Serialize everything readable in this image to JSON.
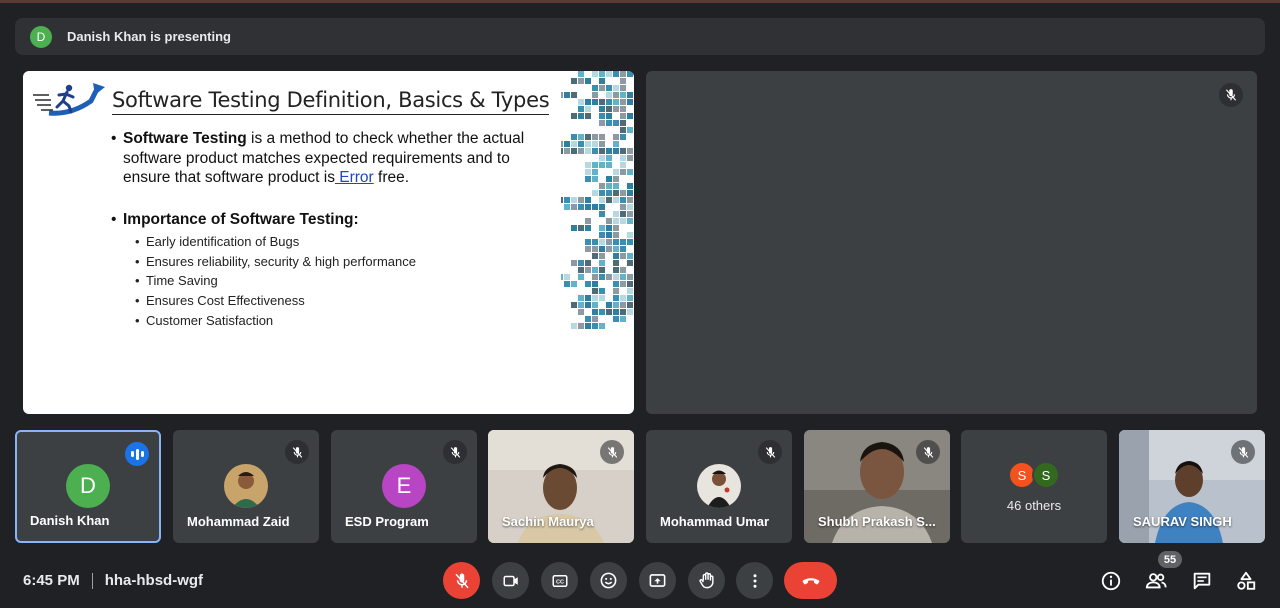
{
  "banner": {
    "initial": "D",
    "text": "Danish Khan is presenting",
    "avatar_color": "#4caf50"
  },
  "slide": {
    "title": "Software Testing Definition, Basics & Types",
    "definition_bold": "Software Testing",
    "definition_text_1": " is a method to check whether the actual software product matches expected requirements and to ensure that software product is",
    "definition_link": " Error",
    "definition_text_2": " free.",
    "importance_heading": "Importance of Software Testing:",
    "importance_items": [
      "Early identification of Bugs",
      "Ensures reliability, security & high performance",
      "Time Saving",
      "Ensures Cost Effectiveness",
      "Customer Satisfaction"
    ]
  },
  "participants": [
    {
      "name": "Danish Khan",
      "initial": "D",
      "color": "#4caf50",
      "speaking": true
    },
    {
      "name": "Mohammad Zaid",
      "photo": true
    },
    {
      "name": "ESD Program",
      "initial": "E",
      "color": "#b845c4"
    },
    {
      "name": "Sachin Maurya",
      "video": true
    },
    {
      "name": "Mohammad Umar",
      "photo": true
    },
    {
      "name": "Shubh Prakash S...",
      "video": true
    },
    {
      "others_label": "46 others",
      "avatars": [
        {
          "initial": "S",
          "color": "#f4511e"
        },
        {
          "initial": "S",
          "color": "#33691e"
        }
      ]
    },
    {
      "name": "SAURAV SINGH",
      "video": true
    }
  ],
  "footer": {
    "time": "6:45 PM",
    "meeting_code": "hha-hbsd-wgf",
    "participant_count": "55"
  },
  "controls": [
    "mic-off-icon",
    "camera-icon",
    "captions-icon",
    "emoji-icon",
    "present-icon",
    "raise-hand-icon",
    "more-icon",
    "end-call-icon"
  ],
  "right_controls": [
    "info-icon",
    "people-icon",
    "chat-icon",
    "activities-icon"
  ]
}
